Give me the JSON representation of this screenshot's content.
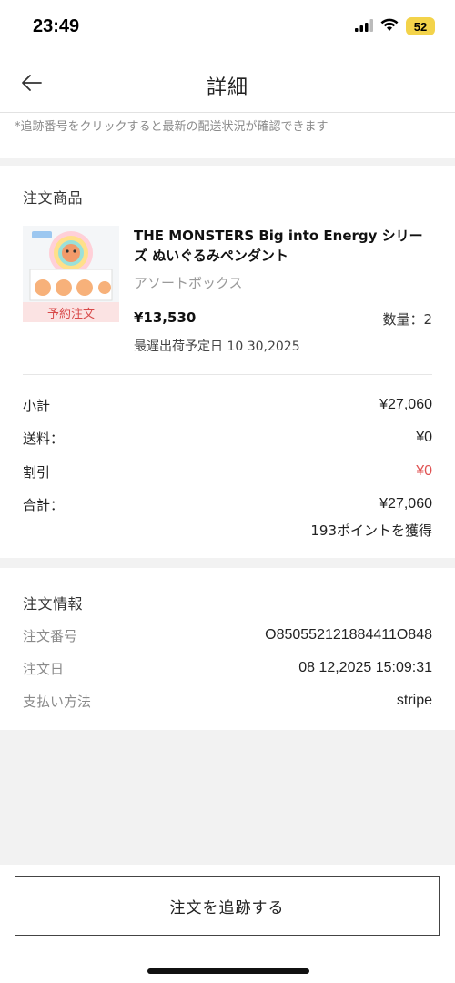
{
  "status_bar": {
    "time": "23:49",
    "battery": "52"
  },
  "header": {
    "title": "詳細",
    "back_icon": "arrow-left-icon"
  },
  "notice": "*追跡番号をクリックすると最新の配送状況が確認できます",
  "order_items": {
    "section_title": "注文商品",
    "product": {
      "name": "THE MONSTERS Big into Energy シリーズ ぬいぐるみペンダント",
      "variant": "アソートボックス",
      "badge": "予約注文",
      "price": "¥13,530",
      "quantity": "数量：2",
      "ship_date": "最遅出荷予定日 10 30,2025"
    },
    "summary": [
      {
        "label": "小計",
        "value": "¥27,060"
      },
      {
        "label": "送料：",
        "value": "¥0"
      },
      {
        "label": "割引",
        "value": "¥0"
      },
      {
        "label": "合計：",
        "value": "¥27,060"
      }
    ],
    "points": "193ポイントを獲得"
  },
  "order_info": {
    "section_title": "注文情報",
    "rows": [
      {
        "label": "注文番号",
        "value": "O850552121884411O848"
      },
      {
        "label": "注文日",
        "value": "08 12,2025 15:09:31"
      },
      {
        "label": "支払い方法",
        "value": "stripe"
      }
    ]
  },
  "actions": {
    "track_label": "注文を追跡する"
  },
  "colors": {
    "accent_red": "#e05252",
    "battery_yellow": "#f3d34a"
  }
}
